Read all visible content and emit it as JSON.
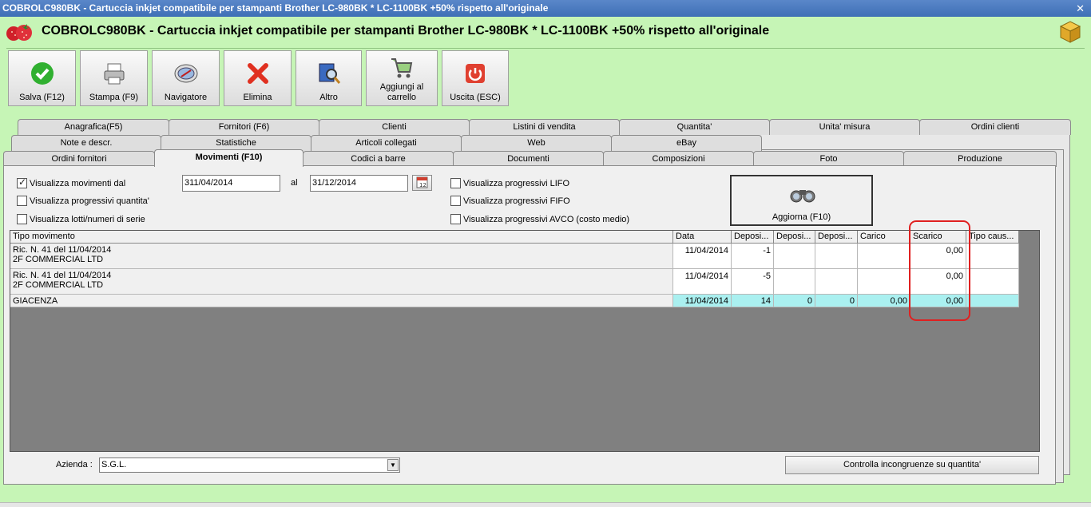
{
  "window": {
    "title": "COBROLC980BK - Cartuccia inkjet compatibile per stampanti Brother LC-980BK * LC-1100BK +50% rispetto all'originale",
    "close": "✕"
  },
  "header": {
    "title": "COBROLC980BK - Cartuccia inkjet compatibile per stampanti Brother LC-980BK * LC-1100BK +50% rispetto all'originale"
  },
  "toolbar": [
    {
      "label": "Salva (F12)",
      "icon": "check-icon"
    },
    {
      "label": "Stampa (F9)",
      "icon": "printer-icon"
    },
    {
      "label": "Navigatore",
      "icon": "compass-icon"
    },
    {
      "label": "Elimina",
      "icon": "delete-x-icon"
    },
    {
      "label": "Altro",
      "icon": "book-search-icon"
    },
    {
      "label": "Aggiungi al carrello",
      "icon": "cart-icon"
    },
    {
      "label": "Uscita (ESC)",
      "icon": "power-icon"
    }
  ],
  "tabs": {
    "row1": [
      "Anagrafica(F5)",
      "Fornitori (F6)",
      "Clienti",
      "Listini di vendita",
      "Quantita'",
      "Unita' misura",
      "Ordini clienti"
    ],
    "row2": [
      "Note e descr.",
      "Statistiche",
      "Articoli collegati",
      "Web",
      "eBay"
    ],
    "row3": [
      "Ordini fornitori",
      "Movimenti (F10)",
      "Codici a barre",
      "Documenti",
      "Composizioni",
      "Foto",
      "Produzione"
    ],
    "active": "Movimenti (F10)"
  },
  "filters": {
    "show_from": {
      "label": "Visualizza movimenti dal",
      "checked": true
    },
    "show_progressive_qty": {
      "label": "Visualizza progressivi quantita'",
      "checked": false
    },
    "show_lots": {
      "label": "Visualizza lotti/numeri di serie",
      "checked": false
    },
    "date_from": "311/04/2014",
    "al_label": "al",
    "date_to": "31/12/2014",
    "lifo": {
      "label": "Visualizza progressivi LIFO",
      "checked": false
    },
    "fifo": {
      "label": "Visualizza progressivi FIFO",
      "checked": false
    },
    "avco": {
      "label": "Visualizza progressivi AVCO (costo medio)",
      "checked": false
    },
    "refresh_label": "Aggiorna (F10)"
  },
  "grid": {
    "columns": [
      "Tipo movimento",
      "Data",
      "Deposi...",
      "Deposi...",
      "Deposi...",
      "Carico",
      "Scarico",
      "Tipo caus..."
    ],
    "rows": [
      {
        "tipo1": "Ric. N. 41 del 11/04/2014",
        "tipo2": "2F COMMERCIAL LTD",
        "data": "11/04/2014",
        "dep1": "-1",
        "dep2": "",
        "dep3": "",
        "carico": "",
        "scarico": "0,00",
        "causale": ""
      },
      {
        "tipo1": "Ric. N. 41 del 11/04/2014",
        "tipo2": "2F COMMERCIAL LTD",
        "data": "11/04/2014",
        "dep1": "-5",
        "dep2": "",
        "dep3": "",
        "carico": "",
        "scarico": "0,00",
        "causale": ""
      }
    ],
    "total": {
      "tipo": "GIACENZA",
      "data": "11/04/2014",
      "dep1": "14",
      "dep2": "0",
      "dep3": "0",
      "carico": "0,00",
      "scarico": "0,00",
      "causale": ""
    }
  },
  "footer": {
    "azienda_label": "Azienda :",
    "azienda_value": "S.G.L.",
    "check_button": "Controlla incongruenze su quantita'"
  },
  "colors": {
    "title_bar": "#3e6fb6",
    "background": "#c6f5b6",
    "highlight": "#e02020",
    "total_row": "#aaf0f0"
  }
}
